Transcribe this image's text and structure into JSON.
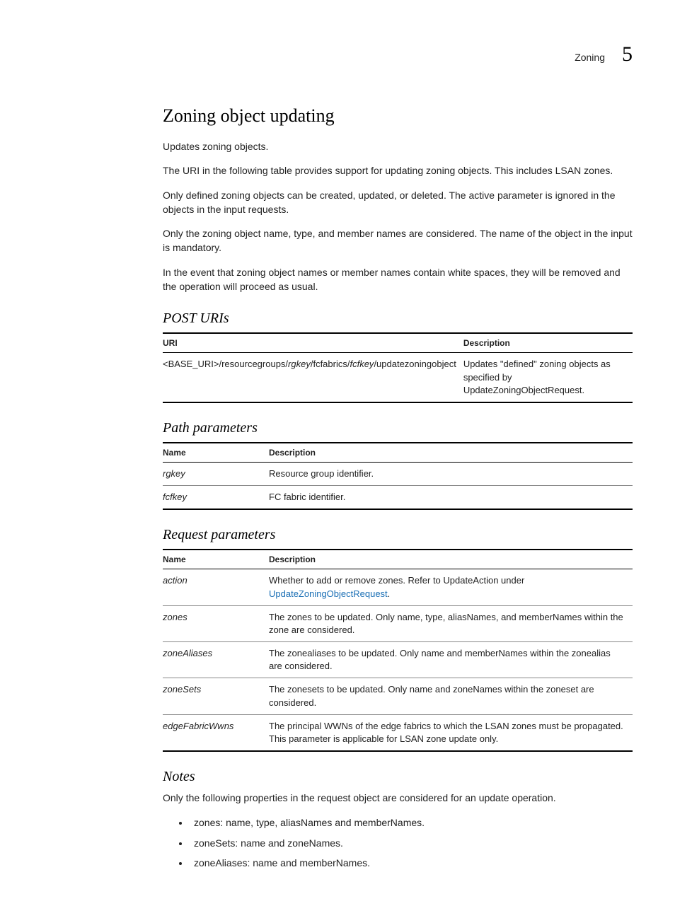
{
  "header": {
    "section": "Zoning",
    "chapter": "5"
  },
  "title": "Zoning object updating",
  "paragraphs": {
    "p1": "Updates zoning objects.",
    "p2": "The URI in the following table provides support for updating zoning objects. This includes LSAN zones.",
    "p3": "Only defined zoning objects can be created, updated, or deleted. The active parameter is ignored in the objects in the input requests.",
    "p4": "Only the zoning object name, type, and member names are considered. The name of the object in the input is mandatory.",
    "p5": "In the event that zoning object names or member names contain white spaces, they will be removed and the operation will proceed as usual."
  },
  "postUris": {
    "heading": "POST URIs",
    "cols": {
      "c1": "URI",
      "c2": "Description"
    },
    "rows": [
      {
        "uri_plain1": "<BASE_URI>/resourcegroups/",
        "uri_it1": "rgkey",
        "uri_plain2": "/fcfabrics/",
        "uri_it2": "fcfkey",
        "uri_plain3": "/updatezoningobject",
        "desc": "Updates \"defined\" zoning objects as specified by UpdateZoningObjectRequest."
      }
    ]
  },
  "pathParams": {
    "heading": "Path parameters",
    "cols": {
      "c1": "Name",
      "c2": "Description"
    },
    "rows": [
      {
        "name": "rgkey",
        "desc": "Resource group identifier."
      },
      {
        "name": "fcfkey",
        "desc": "FC fabric identifier."
      }
    ]
  },
  "requestParams": {
    "heading": "Request parameters",
    "cols": {
      "c1": "Name",
      "c2": "Description"
    },
    "rows": [
      {
        "name": "action",
        "desc_pre": "Whether to add or remove zones. Refer to UpdateAction under ",
        "desc_link": "UpdateZoningObjectRequest",
        "desc_post": "."
      },
      {
        "name": "zones",
        "desc": "The zones to be updated. Only name, type, aliasNames, and memberNames within the zone are considered."
      },
      {
        "name": "zoneAliases",
        "desc": "The zonealiases to be updated. Only name and memberNames within the zonealias are considered."
      },
      {
        "name": "zoneSets",
        "desc": "The zonesets to be updated. Only name  and zoneNames within the zoneset are considered."
      },
      {
        "name": "edgeFabricWwns",
        "desc": "The principal WWNs of the edge fabrics to which the LSAN zones must be propagated. This parameter is applicable for LSAN zone update only."
      }
    ]
  },
  "notes": {
    "heading": "Notes",
    "intro": "Only the following properties in the request object are considered for an update operation.",
    "items": [
      "zones: name, type, aliasNames and memberNames.",
      "zoneSets: name and zoneNames.",
      "zoneAliases: name and memberNames."
    ]
  }
}
